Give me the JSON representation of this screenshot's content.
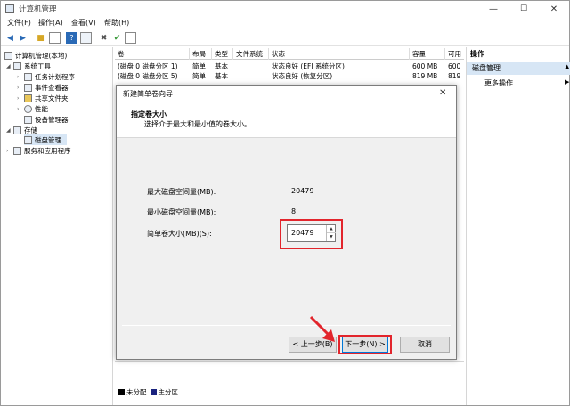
{
  "window": {
    "title": "计算机管理",
    "min": "—",
    "max": "☐",
    "close": "✕"
  },
  "menu": [
    "文件(F)",
    "操作(A)",
    "查看(V)",
    "帮助(H)"
  ],
  "tree": {
    "root": "计算机管理(本地)",
    "system_tools": "系统工具",
    "task_scheduler": "任务计划程序",
    "event_viewer": "事件查看器",
    "shared_folders": "共享文件夹",
    "performance": "性能",
    "device_manager": "设备管理器",
    "storage": "存储",
    "disk_management": "磁盘管理",
    "services": "服务和应用程序"
  },
  "list": {
    "headers": [
      "卷",
      "布局",
      "类型",
      "文件系统",
      "状态",
      "容量",
      "可用"
    ],
    "rows": [
      [
        "(磁盘 0 磁盘分区 1)",
        "简单",
        "基本",
        "",
        "状态良好 (EFI 系统分区)",
        "600 MB",
        "600"
      ],
      [
        "(磁盘 0 磁盘分区 5)",
        "简单",
        "基本",
        "",
        "状态良好 (恢复分区)",
        "819 MB",
        "819"
      ]
    ]
  },
  "actions": {
    "header": "操作",
    "selected": "磁盘管理",
    "more": "更多操作"
  },
  "legend": {
    "unallocated": "未分配",
    "primary": "主分区"
  },
  "dialog": {
    "title": "新建简单卷向导",
    "heading": "指定卷大小",
    "subheading": "选择介于最大和最小值的卷大小。",
    "max_label": "最大磁盘空间量(MB):",
    "max_value": "20479",
    "min_label": "最小磁盘空间量(MB):",
    "min_value": "8",
    "size_label": "简单卷大小(MB)(S):",
    "size_value": "20479",
    "back": "< 上一步(B)",
    "next": "下一步(N) >",
    "cancel": "取消"
  },
  "colors": {
    "highlight": "#e2252c",
    "selection": "#d7e6f5",
    "primary_partition": "#1a237e"
  }
}
